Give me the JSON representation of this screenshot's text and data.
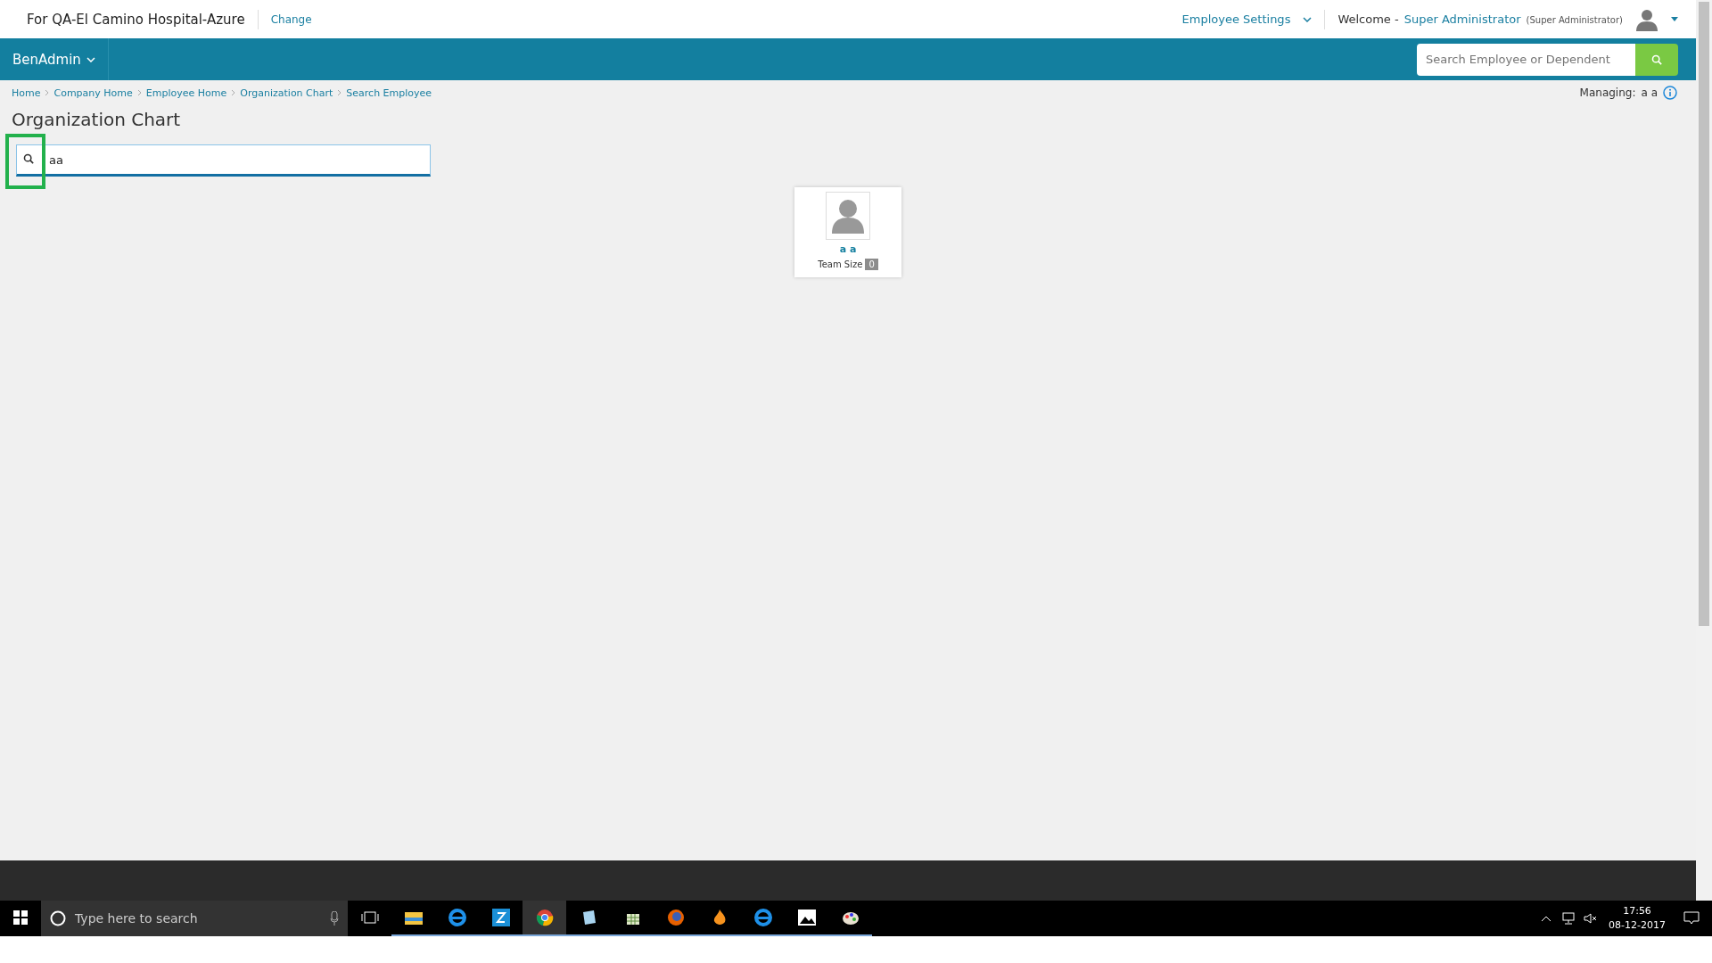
{
  "header": {
    "organization": "For QA-El Camino Hospital-Azure",
    "change_link": "Change",
    "settings_menu": "Employee Settings",
    "welcome": "Welcome -",
    "user_name": "Super Administrator",
    "user_role": "(Super Administrator)"
  },
  "navbar": {
    "menu": "BenAdmin",
    "search": {
      "placeholder": "Search Employee or Dependent"
    }
  },
  "breadcrumbs": [
    "Home",
    "Company Home",
    "Employee Home",
    "Organization Chart",
    "Search Employee"
  ],
  "managing": {
    "label": "Managing:",
    "value": "a a"
  },
  "page_title": "Organization Chart",
  "chart_search": {
    "value": "aa",
    "highlighted": true
  },
  "org_nodes": [
    {
      "name": "a a",
      "team_size_label": "Team Size",
      "team_size": "0"
    }
  ],
  "taskbar": {
    "search_placeholder": "Type here to search",
    "apps": [
      {
        "kind": "folder",
        "open": true,
        "selected": false
      },
      {
        "kind": "edge",
        "open": true,
        "selected": false
      },
      {
        "kind": "zip",
        "open": true,
        "selected": false
      },
      {
        "kind": "chrome",
        "open": true,
        "selected": true
      },
      {
        "kind": "notepad",
        "open": true,
        "selected": false
      },
      {
        "kind": "spreadsheet",
        "open": true,
        "selected": false
      },
      {
        "kind": "firefox",
        "open": true,
        "selected": false
      },
      {
        "kind": "flame",
        "open": true,
        "selected": false
      },
      {
        "kind": "ie",
        "open": true,
        "selected": false
      },
      {
        "kind": "photos",
        "open": true,
        "selected": false
      },
      {
        "kind": "paint",
        "open": true,
        "selected": false
      }
    ],
    "time": "17:56",
    "date": "08-12-2017"
  }
}
